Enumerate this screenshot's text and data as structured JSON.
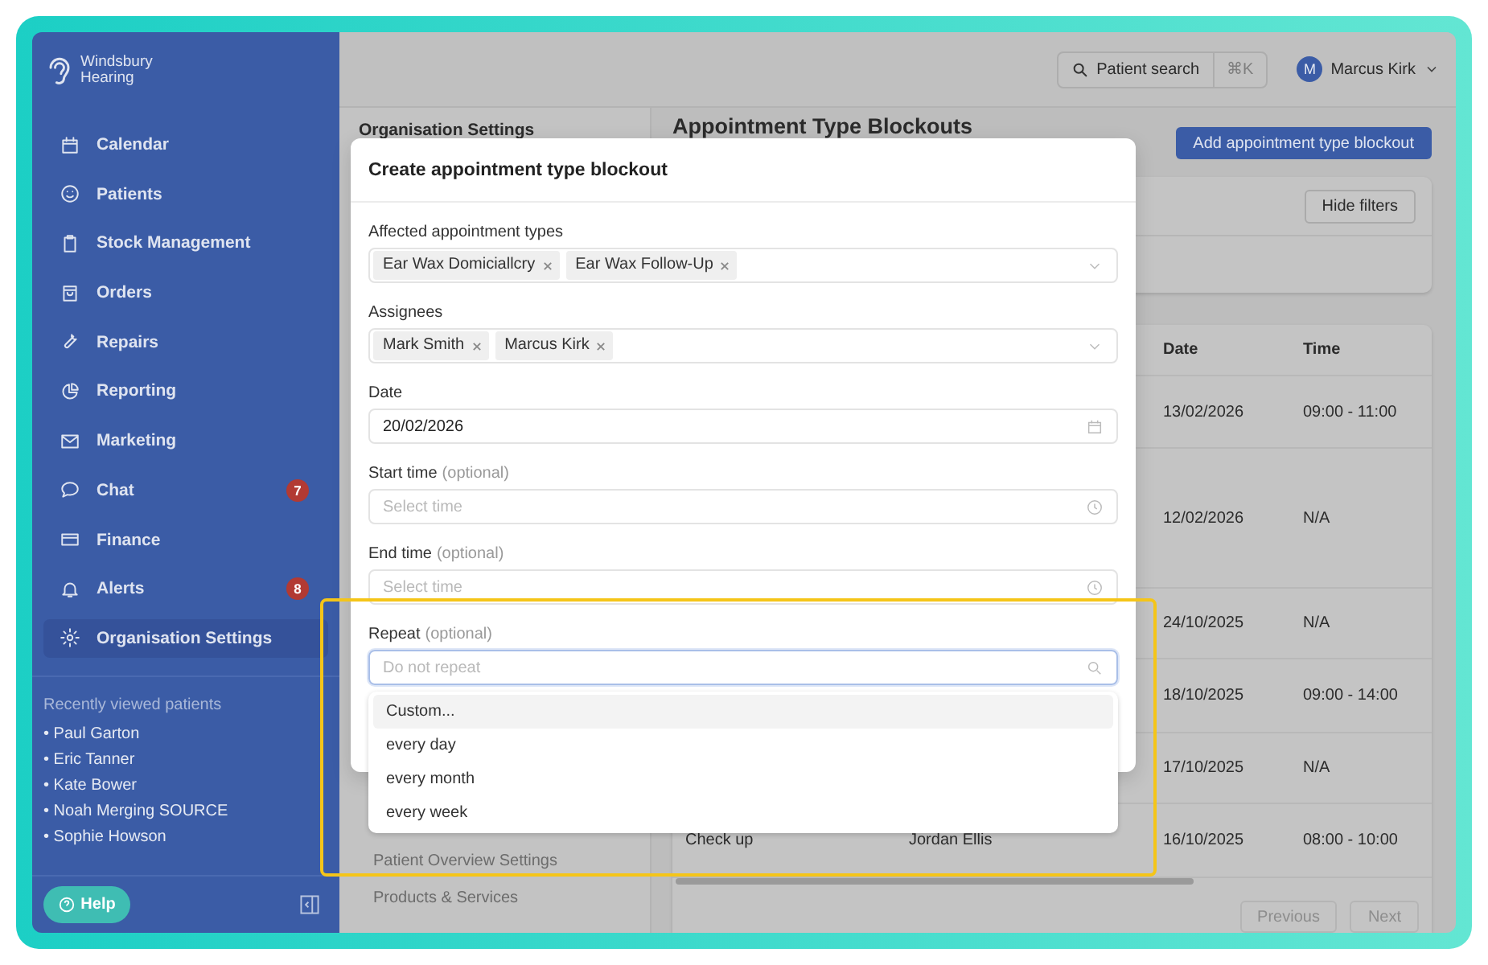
{
  "sidebar": {
    "brand_lines": [
      "Windsbury",
      "Hearing"
    ],
    "nav": [
      {
        "label": "Calendar",
        "selected": false
      },
      {
        "label": "Patients",
        "selected": false
      },
      {
        "label": "Stock Management",
        "selected": false
      },
      {
        "label": "Orders",
        "selected": false
      },
      {
        "label": "Repairs",
        "selected": false
      },
      {
        "label": "Reporting",
        "selected": false
      },
      {
        "label": "Marketing",
        "selected": false
      },
      {
        "label": "Chat",
        "badge": "7",
        "selected": false
      },
      {
        "label": "Finance",
        "selected": false
      },
      {
        "label": "Alerts",
        "badge": "8",
        "selected": false
      },
      {
        "label": "Organisation Settings",
        "selected": true
      }
    ],
    "recent_title": "Recently viewed patients",
    "recent_patients": [
      "• Paul Garton",
      "• Eric Tanner",
      "• Kate Bower",
      "• Noah Merging SOURCE",
      "• Sophie Howson"
    ],
    "help": "Help"
  },
  "topbar": {
    "search": "Patient search",
    "shortcut": "⌘K",
    "avatar": "M",
    "user": "Marcus Kirk"
  },
  "settings_nav": {
    "title": "Organisation Settings",
    "items": [
      "Patient Overview Settings",
      "Products & Services"
    ]
  },
  "page": {
    "title": "Appointment Type Blockouts",
    "add_button": "Add appointment type blockout",
    "hide_filters": "Hide filters"
  },
  "table": {
    "columns": [
      "Date",
      "Time"
    ],
    "rows": [
      {
        "date": "13/02/2026",
        "time": "09:00 - 11:00"
      },
      {
        "date": "12/02/2026",
        "time": "N/A"
      },
      {
        "date": "24/10/2025",
        "time": "N/A"
      },
      {
        "date": "18/10/2025",
        "time": "09:00 - 14:00"
      },
      {
        "date": "17/10/2025",
        "time": "N/A"
      },
      {
        "column_1": "Check up",
        "column_2": "Jordan Ellis",
        "date": "16/10/2025",
        "time": "08:00 - 10:00"
      }
    ],
    "pagination": {
      "previous": "Previous",
      "next": "Next",
      "disabled": true
    }
  },
  "modal": {
    "title": "Create appointment type blockout",
    "fields": [
      {
        "kind": "multiselect",
        "label": "Affected appointment types",
        "tags": [
          "Ear Wax Domiciallcry",
          "Ear Wax Follow-Up"
        ]
      },
      {
        "kind": "multiselect",
        "label": "Assignees",
        "tags": [
          "Mark Smith",
          "Marcus Kirk"
        ]
      },
      {
        "kind": "date",
        "label": "Date",
        "value": "20/02/2026"
      },
      {
        "kind": "time",
        "label": "Start time",
        "hint": "(optional)",
        "placeholder": "Select time"
      },
      {
        "kind": "time",
        "label": "End time",
        "hint": "(optional)",
        "placeholder": "Select time"
      },
      {
        "kind": "search",
        "label": "Repeat",
        "hint": "(optional)",
        "placeholder": "Do not repeat",
        "focused": true
      }
    ],
    "dropdown": [
      {
        "label": "Custom...",
        "selected": true
      },
      {
        "label": "every day",
        "selected": false
      },
      {
        "label": "every month",
        "selected": false
      },
      {
        "label": "every week",
        "selected": false
      }
    ]
  }
}
